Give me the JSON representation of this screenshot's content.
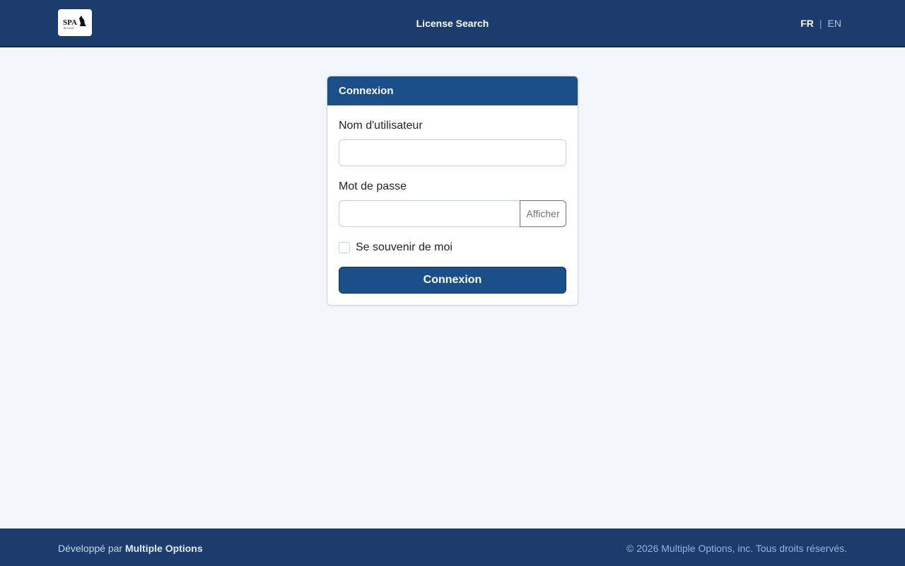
{
  "header": {
    "logo_alt": "SPA",
    "title": "License Search",
    "languages": {
      "fr": "FR",
      "separator": "|",
      "en": "EN"
    }
  },
  "login": {
    "card_title": "Connexion",
    "username_label": "Nom d'utilisateur",
    "username_value": "",
    "password_label": "Mot de passe",
    "password_value": "",
    "show_password_label": "Afficher",
    "remember_label": "Se souvenir de moi",
    "remember_checked": false,
    "submit_label": "Connexion"
  },
  "footer": {
    "developed_by": "Développé par",
    "developer_name": "Multiple Options",
    "copyright": "© 2026 Multiple Options, inc. Tous droits réservés."
  },
  "colors": {
    "header_bg": "#1b3c6d",
    "card_header_bg": "#1b4f8a",
    "page_bg": "#f3f7fc"
  }
}
